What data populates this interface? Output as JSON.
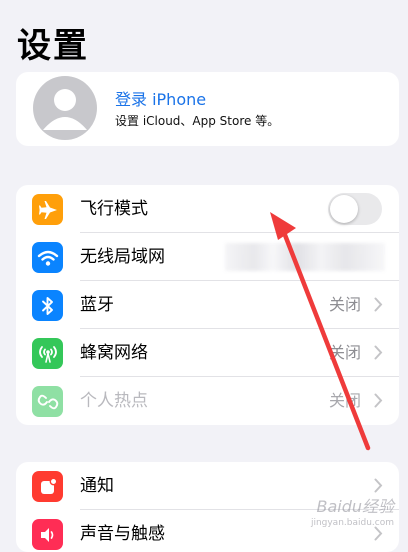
{
  "page_title": "设置",
  "account": {
    "signin_label": "登录 iPhone",
    "subtitle": "设置 iCloud、App Store 等。"
  },
  "group1": [
    {
      "label": "飞行模式",
      "icon": "airplane-icon",
      "color": "#ff9f0a",
      "toggle_on": false
    },
    {
      "label": "无线局域网",
      "icon": "wifi-icon",
      "color": "#0a84ff"
    },
    {
      "label": "蓝牙",
      "icon": "bluetooth-icon",
      "color": "#0a84ff",
      "value": "关闭"
    },
    {
      "label": "蜂窝网络",
      "icon": "cellular-icon",
      "color": "#34c759",
      "value": "关闭"
    },
    {
      "label": "个人热点",
      "icon": "hotspot-icon",
      "color": "#34c759",
      "value": "关闭",
      "disabled": true
    }
  ],
  "group2": [
    {
      "label": "通知",
      "icon": "notification-icon",
      "color": "#ff3b30"
    },
    {
      "label": "声音与触感",
      "icon": "sound-icon",
      "color": "#ff2d55"
    }
  ],
  "watermark": {
    "brand": "Baidu经验",
    "url": "jingyan.baidu.com"
  }
}
